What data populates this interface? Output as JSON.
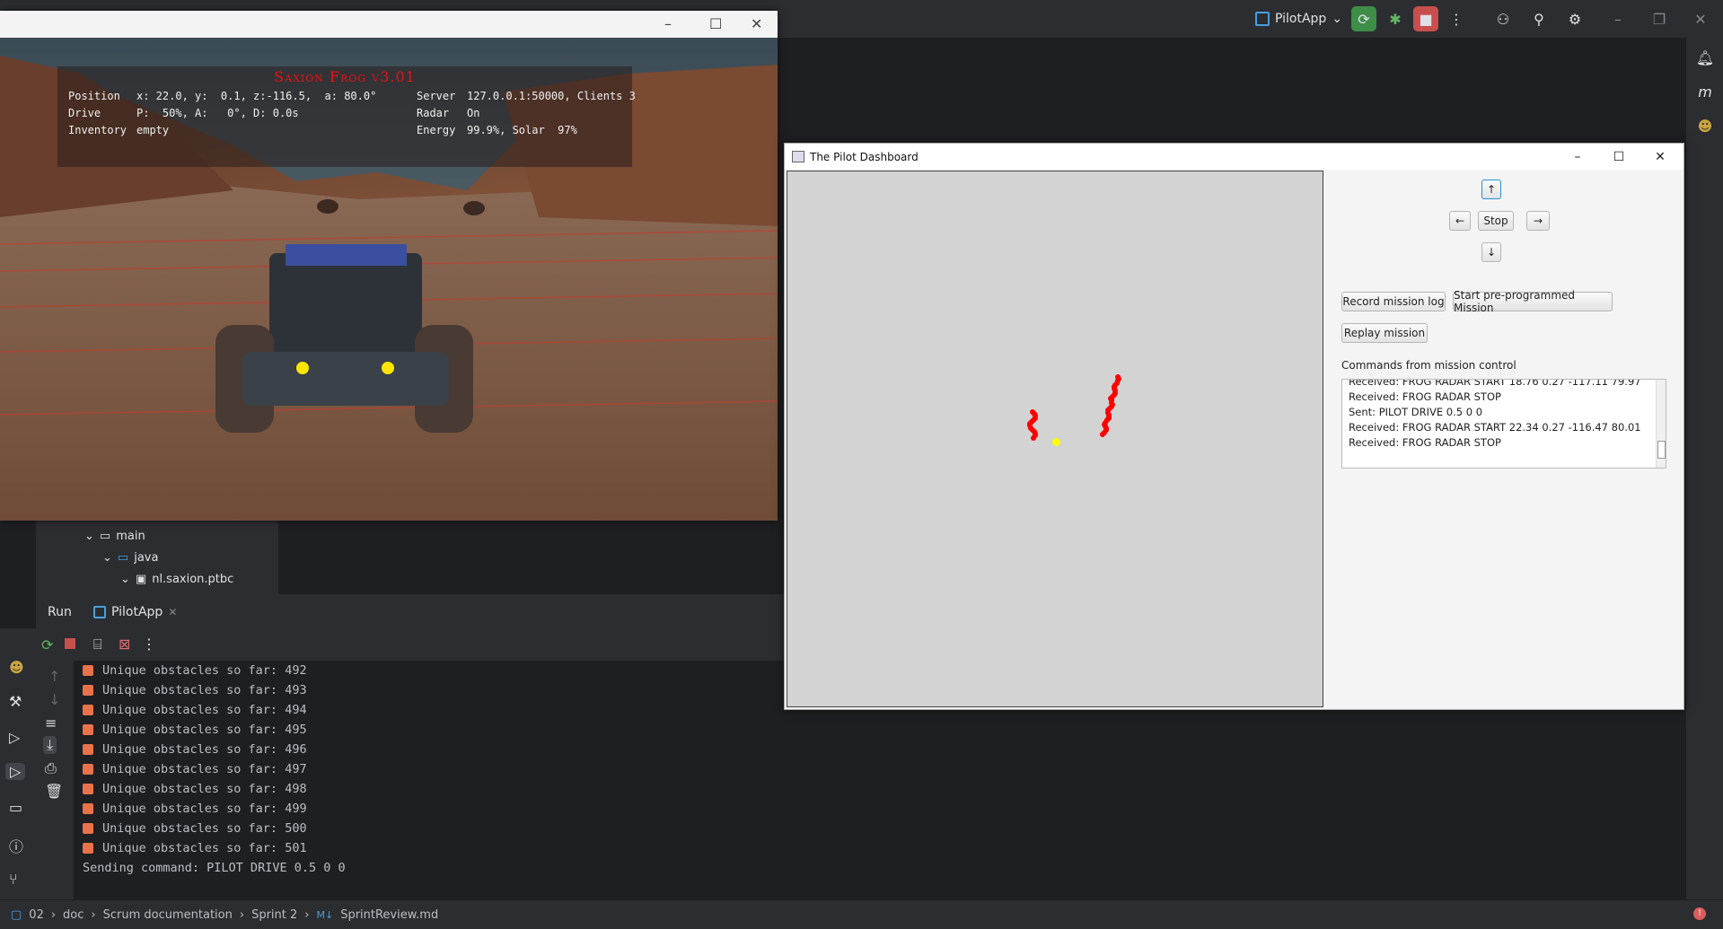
{
  "ide": {
    "run_config_name": "PilotApp",
    "run_tab_label": "Run",
    "run_config_tab": "PilotApp",
    "tree": [
      "main",
      "java",
      "nl.saxion.ptbc"
    ],
    "console_lines": [
      "Unique obstacles so far: 492",
      "Unique obstacles so far: 493",
      "Unique obstacles so far: 494",
      "Unique obstacles so far: 495",
      "Unique obstacles so far: 496",
      "Unique obstacles so far: 497",
      "Unique obstacles so far: 498",
      "Unique obstacles so far: 499",
      "Unique obstacles so far: 500",
      "Unique obstacles so far: 501"
    ],
    "console_last": "Sending command: PILOT DRIVE 0.5 0 0",
    "breadcrumb": [
      "02",
      "doc",
      "Scrum documentation",
      "Sprint 2",
      "SprintReview.md"
    ],
    "colors": {
      "run_green": "#3e8e48",
      "stop_red": "#c94f4f",
      "orange": "#e8734a"
    }
  },
  "game": {
    "title": "Saxion Frog v3.01",
    "rows": [
      {
        "label": "Position",
        "value": "x: 22.0, y:  0.1, z:-116.5,  a: 80.0°"
      },
      {
        "label": "Drive",
        "value": "P:  50%, A:   0°, D: 0.0s"
      },
      {
        "label": "Inventory",
        "value": "empty"
      }
    ],
    "rows_right": [
      {
        "label": "Server",
        "value": "127.0.0.1:50000, Clients 3"
      },
      {
        "label": "Radar",
        "value": "On"
      },
      {
        "label": "Energy",
        "value": "99.9%, Solar  97%"
      }
    ]
  },
  "dashboard": {
    "title": "The Pilot Dashboard",
    "up": "↑",
    "down": "↓",
    "left": "←",
    "right": "→",
    "stop": "Stop",
    "record": "Record mission log",
    "start_preprogrammed": "Start pre-programmed Mission",
    "replay": "Replay mission",
    "commands_label": "Commands from mission control",
    "log": [
      "Received: FROG RADAR START 18.76 0.27 -117.11 79.97",
      "Received: FROG RADAR STOP",
      "Sent: PILOT DRIVE 0.5 0 0",
      "Received: FROG RADAR START 22.34 0.27 -116.47 80.01",
      "Received: FROG RADAR STOP"
    ]
  }
}
